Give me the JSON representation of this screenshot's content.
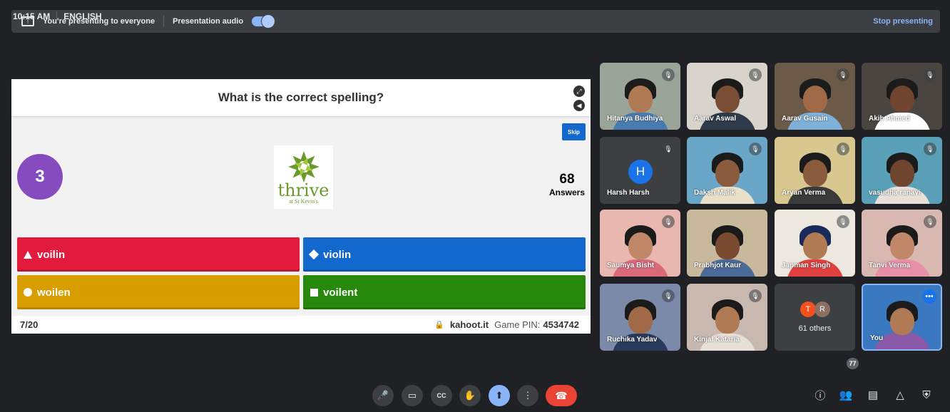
{
  "topbar": {
    "presenting_text": "You're presenting to everyone",
    "audio_label": "Presentation audio",
    "audio_on": true,
    "stop_label": "Stop presenting"
  },
  "slide": {
    "question": "What is the correct spelling?",
    "skip_label": "Skip",
    "timer": "3",
    "logo_word": "thrive",
    "logo_sub": "at St Kevin's",
    "answers_count": "68",
    "answers_label": "Answers",
    "options": [
      {
        "shape": "triangle",
        "text": "voilin",
        "color": "#e21b3c"
      },
      {
        "shape": "diamond",
        "text": "violin",
        "color": "#1368ce"
      },
      {
        "shape": "circle",
        "text": "woilen",
        "color": "#d89e00"
      },
      {
        "shape": "square",
        "text": "voilent",
        "color": "#26890c"
      }
    ],
    "progress": "7/20",
    "site": "kahoot.it",
    "pin_label": "Game PIN:",
    "pin": "4534742"
  },
  "participants": [
    {
      "name": "Hitanya Budhiya",
      "muted": true
    },
    {
      "name": "Aarav Aswal",
      "muted": true
    },
    {
      "name": "Aarav Gusain",
      "muted": true
    },
    {
      "name": "Akib Ahmed",
      "muted": true
    },
    {
      "name": "Harsh Harsh",
      "muted": true,
      "initial": "H"
    },
    {
      "name": "Daksh Malik",
      "muted": true
    },
    {
      "name": "Aryan Verma",
      "muted": true
    },
    {
      "name": "vasudha ranavi",
      "muted": true
    },
    {
      "name": "Saumya Bisht",
      "muted": true
    },
    {
      "name": "Prabhjot Kaur",
      "muted": false
    },
    {
      "name": "Japman Singh",
      "muted": true
    },
    {
      "name": "Tanvi Verma",
      "muted": true
    },
    {
      "name": "Ruchika Yadav",
      "muted": true
    },
    {
      "name": "Kinjal Kataria",
      "muted": true
    }
  ],
  "others": {
    "initials": [
      "T",
      "R"
    ],
    "label": "61 others"
  },
  "you": {
    "name": "You"
  },
  "bottombar": {
    "time": "10:15 AM",
    "language": "ENGLISH",
    "people_count": "77",
    "colors": {
      "hangup": "#ea4335",
      "active": "#8ab4f8"
    }
  }
}
